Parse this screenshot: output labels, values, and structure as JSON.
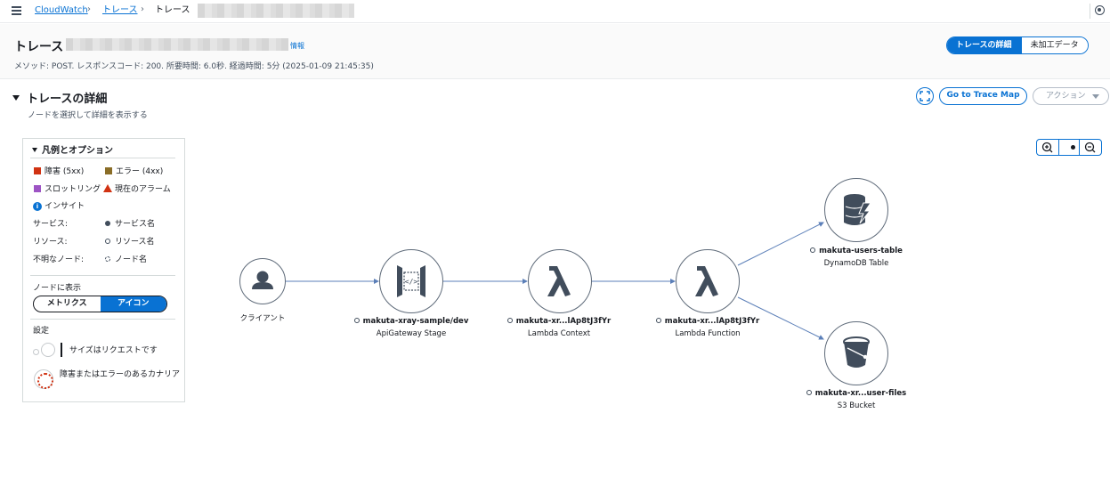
{
  "breadcrumb": {
    "items": [
      "CloudWatch",
      "トレース",
      "トレース"
    ]
  },
  "header": {
    "title": "トレース",
    "info_link": "情報",
    "meta": "メソッド: POST. レスポンスコード: 200. 所要時間: 6.0秒. 経過時間: 5分 (2025-01-09 21:45:35)",
    "tabs": [
      {
        "label": "トレースの詳細",
        "selected": true
      },
      {
        "label": "未加工データ",
        "selected": false
      }
    ]
  },
  "section": {
    "title": "トレースの詳細",
    "subtitle": "ノードを選択して詳細を表示する",
    "go_to_trace_map": "Go to Trace Map",
    "actions_label": "アクション"
  },
  "legend": {
    "title": "凡例とオプション",
    "fault": {
      "label": "障害 (5xx)",
      "color": "#d13212"
    },
    "error": {
      "label": "エラー (4xx)",
      "color": "#8a6d27"
    },
    "throttle": {
      "label": "スロットリング",
      "color": "#9d54c4"
    },
    "alarm": {
      "label": "現在のアラーム",
      "color": "#d13212"
    },
    "insight": {
      "label": "インサイト",
      "color": "#0972d3"
    },
    "service_label": "サービス:",
    "service_value": "サービス名",
    "resource_label": "リソース:",
    "resource_value": "リソース名",
    "unknown_label": "不明なノード:",
    "unknown_value": "ノード名",
    "display_label": "ノードに表示",
    "display_options": [
      {
        "label": "メトリクス",
        "selected": false
      },
      {
        "label": "アイコン",
        "selected": true
      }
    ],
    "settings_label": "設定",
    "size_note": "サイズはリクエストです",
    "canary_note": "障害またはエラーのあるカナリア"
  },
  "graph": {
    "nodes": [
      {
        "name": "",
        "type": "クライアント",
        "icon": "user-icon"
      },
      {
        "name": "makuta-xray-sample/dev",
        "type": "ApiGateway Stage",
        "icon": "api-gateway-icon"
      },
      {
        "name": "makuta-xr...lAp8tJ3fYr",
        "type": "Lambda Context",
        "icon": "lambda-icon"
      },
      {
        "name": "makuta-xr...lAp8tJ3fYr",
        "type": "Lambda Function",
        "icon": "lambda-icon"
      },
      {
        "name": "makuta-users-table",
        "type": "DynamoDB Table",
        "icon": "dynamodb-icon"
      },
      {
        "name": "makuta-xr...user-files",
        "type": "S3 Bucket",
        "icon": "s3-bucket-icon"
      }
    ],
    "edge_color": "#5b7fb8"
  }
}
